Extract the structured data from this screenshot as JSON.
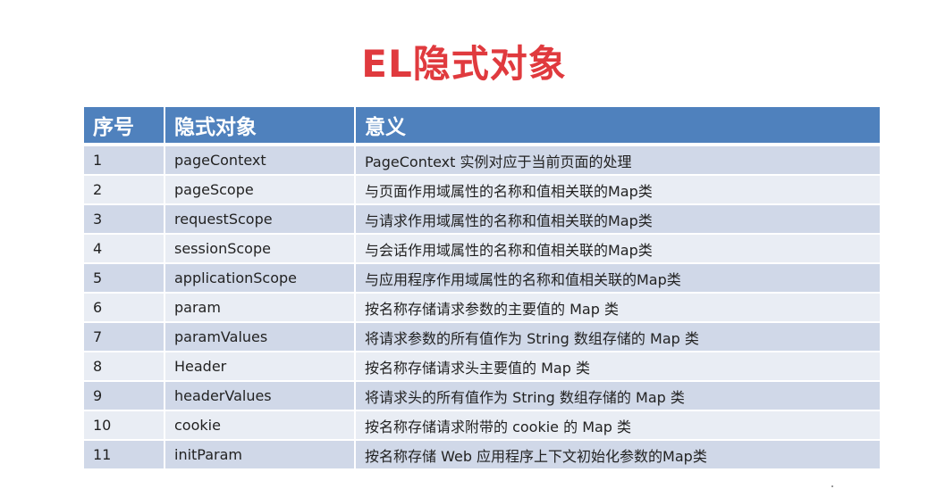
{
  "title": "EL隐式对象",
  "table": {
    "headers": [
      "序号",
      "隐式对象",
      "意义"
    ],
    "rows": [
      [
        "1",
        "pageContext",
        "PageContext 实例对应于当前页面的处理"
      ],
      [
        "2",
        "pageScope",
        "与页面作用域属性的名称和值相关联的Map类"
      ],
      [
        "3",
        "requestScope",
        "与请求作用域属性的名称和值相关联的Map类"
      ],
      [
        "4",
        "sessionScope",
        "与会话作用域属性的名称和值相关联的Map类"
      ],
      [
        "5",
        "applicationScope",
        "与应用程序作用域属性的名称和值相关联的Map类"
      ],
      [
        "6",
        "param",
        "按名称存储请求参数的主要值的 Map 类"
      ],
      [
        "7",
        "paramValues",
        "将请求参数的所有值作为 String 数组存储的 Map 类"
      ],
      [
        "8",
        "Header",
        "按名称存储请求头主要值的 Map 类"
      ],
      [
        "9",
        "headerValues",
        "将请求头的所有值作为 String 数组存储的 Map 类"
      ],
      [
        "10",
        "cookie",
        "按名称存储请求附带的 cookie 的 Map 类"
      ],
      [
        "11",
        "initParam",
        "按名称存储 Web 应用程序上下文初始化参数的Map类"
      ]
    ]
  },
  "colors": {
    "title": "#e03a3e",
    "header_bg": "#4f81bd",
    "row_odd": "#d0d8e8",
    "row_even": "#e9edf4"
  }
}
